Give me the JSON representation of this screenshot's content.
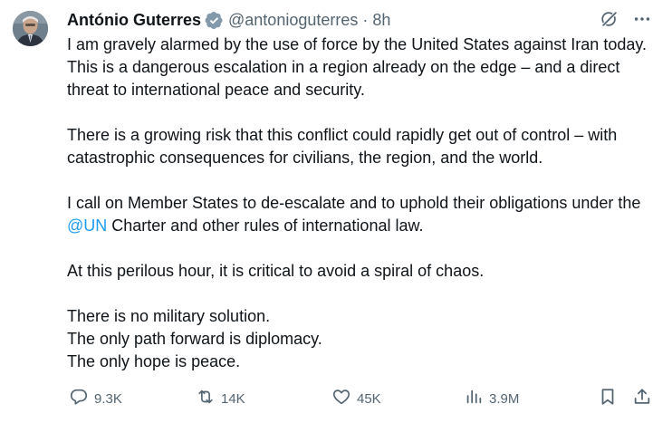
{
  "author": {
    "name": "António Guterres",
    "handle": "@antonioguterres",
    "separator": "·",
    "time": "8h",
    "verified": true
  },
  "tweet": {
    "paragraphs": [
      "I am gravely alarmed by the use of force by the United States against Iran today. This is a dangerous escalation in a region already on the edge – and a direct threat to international peace and security.",
      "There is a growing risk that this conflict could rapidly get out of control – with catastrophic consequences for civilians, the region, and the world.",
      {
        "before": "I call on Member States to de-escalate and to uphold their obligations under the ",
        "mention": "@UN",
        "after": " Charter and other rules of international law."
      },
      "At this perilous hour, it is critical to avoid a spiral of chaos.",
      "There is no military solution.\nThe only path forward is diplomacy.\nThe only hope is peace."
    ]
  },
  "stats": {
    "replies": "9.3K",
    "reposts": "14K",
    "likes": "45K",
    "views": "3.9M"
  },
  "icons": {
    "verified": "verified-badge-icon",
    "grok": "grok-icon",
    "more": "more-icon",
    "reply": "reply-icon",
    "repost": "repost-icon",
    "like": "heart-icon",
    "views": "views-icon",
    "bookmark": "bookmark-icon",
    "share": "share-icon"
  },
  "colors": {
    "text": "#0f1419",
    "secondary": "#536471",
    "link": "#1d9bf0",
    "verified": "#829aab"
  }
}
